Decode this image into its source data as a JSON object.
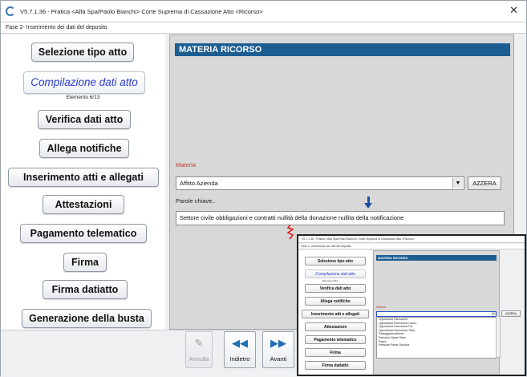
{
  "window": {
    "title": "V5.7.1.36 - Pratica <Alfa Spa/Paolo Bianchi>   Corte Suprema di Cassazione   Atto <Ricorso>",
    "close_glyph": "✕",
    "step": "Fase 2- Inserimento dei dati del deposito"
  },
  "sidebar": {
    "items": [
      {
        "label": "Selezione tipo atto"
      },
      {
        "label": "Compilazione dati atto",
        "sub": "Elemento 6/13"
      },
      {
        "label": "Verifica dati atto"
      },
      {
        "label": "Allega notifiche"
      },
      {
        "label": "Inserimento atti e allegati"
      },
      {
        "label": "Attestazioni"
      },
      {
        "label": "Pagamento telematico"
      },
      {
        "label": "Firma"
      },
      {
        "label": "Firma datiatto"
      },
      {
        "label": "Generazione della busta"
      }
    ]
  },
  "main": {
    "header": "MATERIA RICORSO",
    "materia_label": "Materia",
    "materia_value": "Affitto Azienda",
    "azzera_label": "AZZERA",
    "parole_label": "Parole chiave..",
    "parole_value": "Settore civile obbligazioni e contratti nullità della donazione nullita della notificazione"
  },
  "footer": {
    "annulla": "Annulla",
    "indietro": "Indietro",
    "avanti": "Avanti"
  },
  "inset": {
    "title": "V5.7.1.36 - Pratica <Alfa Spa/Paolo Bianchi>   Corte Suprema di Cassazione   Atto <Ricorso>",
    "step": "Fase 2- Inserimento dei dati del deposito",
    "header": "MATERIA RICORSO",
    "materia_label": "Materia",
    "azzera_label": "AZZERA",
    "sub": "Elemento 6/13",
    "nav": [
      "Selezione tipo atto",
      "Compilazione dati atto",
      "Verifica dati atto",
      "Allega notifiche",
      "Inserimento atti e allegati",
      "Attestazioni",
      "Pagamento telematico",
      "Firma",
      "Firma datiatto"
    ],
    "options": [
      "Opposizione Esecuzione",
      "Opposizione Esecuzione Lavoro",
      "Opposizione Esecuzione P.A.",
      "Opposizione Esecuzione Titolo",
      "Passaggio/mutazione",
      "Patrocinio Spese Stato",
      "Pegno",
      "Pensione Forme Giuridica"
    ]
  }
}
